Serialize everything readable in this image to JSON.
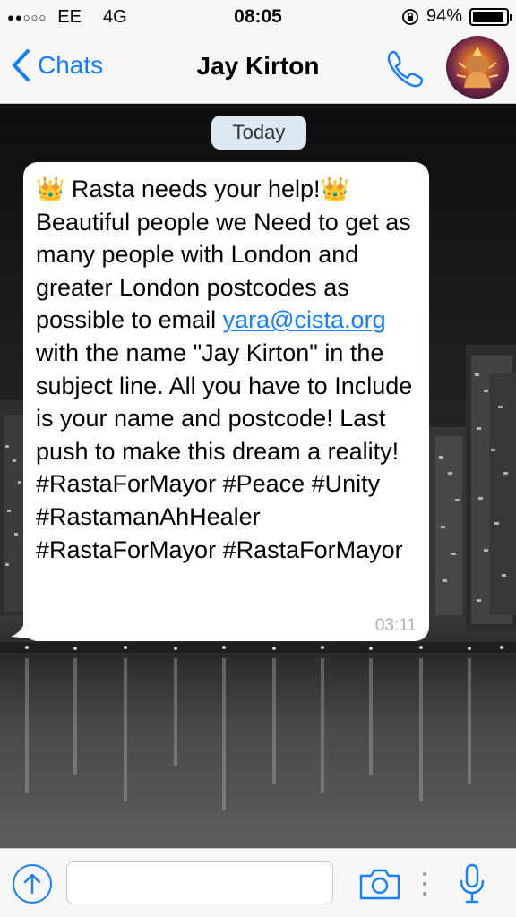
{
  "status_bar": {
    "signal": "●●○○○",
    "carrier": "EE",
    "network": "4G",
    "time": "08:05",
    "battery_percent": "94%",
    "battery_level": 0.94
  },
  "nav": {
    "back_label": "Chats",
    "contact_name": "Jay Kirton"
  },
  "chat": {
    "date_label": "Today",
    "message": {
      "crown_emoji": "👑",
      "headline": " Rasta needs your help!",
      "body_before_link": "Beautiful people we Need to get as many people with London and greater London postcodes as possible to email ",
      "email": "yara@cista.org",
      "body_after_link": " with the name \"Jay Kirton\" in the subject line. All you have to Include is your name and postcode! Last push to make this dream a reality! #RastaForMayor #Peace #Unity #RastamanAhHealer #RastaForMayor #RastaForMayor",
      "time": "03:11"
    }
  },
  "input_bar": {
    "placeholder": "",
    "icons": [
      "upload-icon",
      "camera-icon",
      "microphone-icon"
    ]
  },
  "colors": {
    "accent": "#147efb",
    "bar_background": "#f7f7f7",
    "date_chip": "#dde8f2",
    "bubble": "#ffffff"
  }
}
